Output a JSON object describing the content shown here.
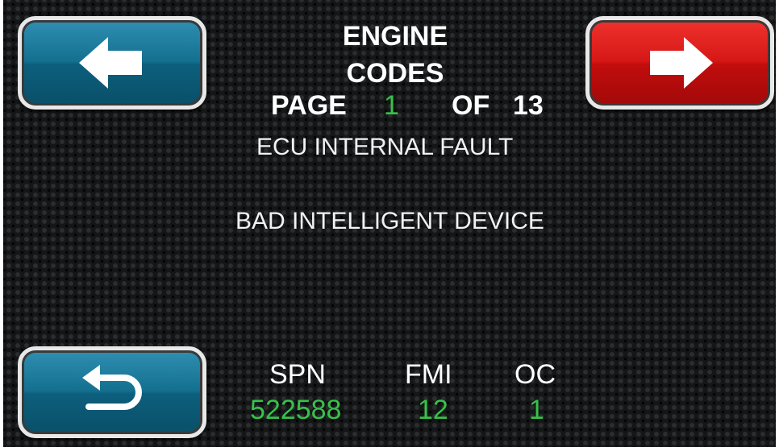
{
  "header": {
    "title_line1": "ENGINE",
    "title_line2": "CODES",
    "page_word": "PAGE",
    "page_current": "1",
    "of_word": "OF",
    "page_total": "13"
  },
  "faults": {
    "description1": "ECU INTERNAL FAULT",
    "description2": "BAD INTELLIGENT DEVICE"
  },
  "codes": {
    "spn_label": "SPN",
    "fmi_label": "FMI",
    "oc_label": "OC",
    "spn_value": "522588",
    "fmi_value": "12",
    "oc_value": "1"
  },
  "buttons": {
    "prev": {
      "icon": "arrow-left-icon",
      "color": "#14708f"
    },
    "next": {
      "icon": "arrow-right-icon",
      "color": "#d51716"
    },
    "back": {
      "icon": "return-icon",
      "color": "#14708f"
    }
  },
  "colors": {
    "accent_green": "#36c24a",
    "text": "#ffffff"
  }
}
